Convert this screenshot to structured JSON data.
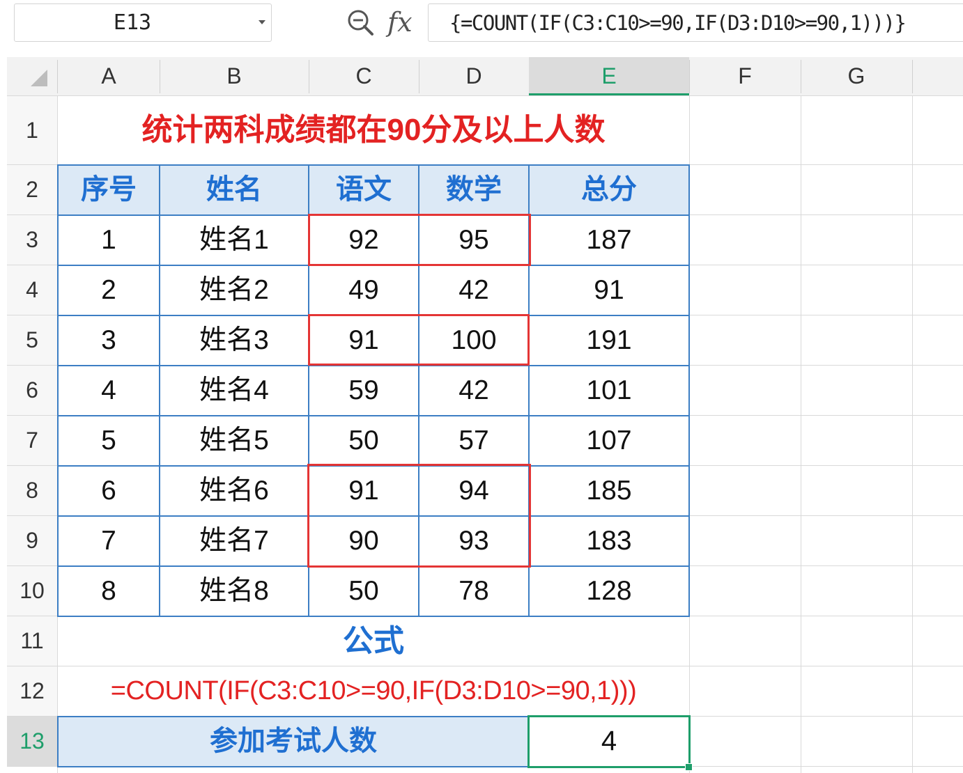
{
  "formula_bar": {
    "name_box": "E13",
    "fx_symbol": "fx",
    "formula": "{=COUNT(IF(C3:C10>=90,IF(D3:D10>=90,1)))}"
  },
  "columns": [
    "A",
    "B",
    "C",
    "D",
    "E",
    "F",
    "G"
  ],
  "rows": [
    "1",
    "2",
    "3",
    "4",
    "5",
    "6",
    "7",
    "8",
    "9",
    "10",
    "11",
    "12",
    "13"
  ],
  "sheet": {
    "title": "统计两科成绩都在90分及以上人数",
    "headers": [
      "序号",
      "姓名",
      "语文",
      "数学",
      "总分"
    ],
    "data": [
      [
        "1",
        "姓名1",
        "92",
        "95",
        "187"
      ],
      [
        "2",
        "姓名2",
        "49",
        "42",
        "91"
      ],
      [
        "3",
        "姓名3",
        "91",
        "100",
        "191"
      ],
      [
        "4",
        "姓名4",
        "59",
        "42",
        "101"
      ],
      [
        "5",
        "姓名5",
        "50",
        "57",
        "107"
      ],
      [
        "6",
        "姓名6",
        "91",
        "94",
        "185"
      ],
      [
        "7",
        "姓名7",
        "90",
        "93",
        "183"
      ],
      [
        "8",
        "姓名8",
        "50",
        "78",
        "128"
      ]
    ],
    "formula_label": "公式",
    "formula_text": "=COUNT(IF(C3:C10>=90,IF(D3:D10>=90,1)))",
    "result_label": "参加考试人数",
    "result_value": "4"
  },
  "colors": {
    "accent_green": "#1e9e6a",
    "header_blue": "#1f6fd1",
    "highlight_red": "#e43535",
    "header_fill": "#dce9f6"
  },
  "icons": [
    "zoom-icon",
    "fx-icon",
    "dropdown-arrow-icon",
    "select-all-icon"
  ]
}
